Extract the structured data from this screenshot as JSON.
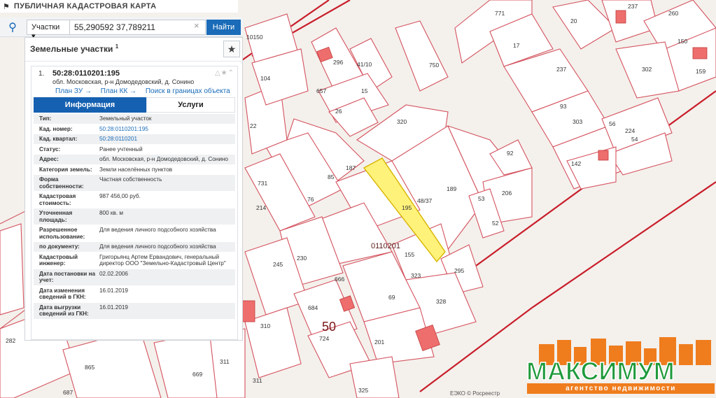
{
  "app": {
    "title": "ПУБЛИЧНАЯ КАДАСТРОВАЯ КАРТА"
  },
  "search": {
    "type_label": "Участки",
    "query": "55,290592 37,789211",
    "find_label": "Найти"
  },
  "panel": {
    "title": "Земельные участки",
    "count_sup": "1"
  },
  "card": {
    "index": "1.",
    "cadastral_number": "50:28:0110201:195",
    "address": "обл. Московская, р-н Домодедовский, д. Сонино",
    "links": [
      "План ЗУ →",
      "План КК →",
      "Поиск в границах объекта →"
    ]
  },
  "tabs": {
    "info": "Информация",
    "services": "Услуги"
  },
  "properties": [
    {
      "key": "Тип:",
      "value": "Земельный участок"
    },
    {
      "key": "Кад. номер:",
      "value": "50:28:0110201:195"
    },
    {
      "key": "Кад. квартал:",
      "value": "50:28:0110201"
    },
    {
      "key": "Статус:",
      "value": "Ранее учтенный"
    },
    {
      "key": "Адрес:",
      "value": "обл. Московская, р-н Домодедовский, д. Сонино"
    },
    {
      "key": "Категория земель:",
      "value": "Земли населённых пунктов"
    },
    {
      "key": "Форма собственности:",
      "value": "Частная собственность"
    },
    {
      "key": "Кадастровая стоимость:",
      "value": "987 456,00 руб."
    },
    {
      "key": "Уточненная площадь:",
      "value": "800 кв. м"
    },
    {
      "key": "Разрешенное использование:",
      "value": "Для ведения личного подсобного хозяйства"
    },
    {
      "key": "по документу:",
      "value": "Для ведения личного подсобного хозяйства"
    },
    {
      "key": "Кадастровый инженер:",
      "value": "Григорьянц Артем Ервандович, генеральный директор ООО \"Земельно-Кадастровый Центр\""
    },
    {
      "key": "Дата постановки на учет:",
      "value": "02.02.2006"
    },
    {
      "key": "Дата изменения сведений в ГКН:",
      "value": "16.01.2019"
    },
    {
      "key": "Дата выгрузки сведений из ГКН:",
      "value": "16.01.2019"
    }
  ],
  "map": {
    "quarter_label": "0110201",
    "region_label": "50",
    "highlight_label": "195",
    "attribution": "ЕЭКО © Росреестр",
    "parcel_numbers": [
      "771",
      "237",
      "17",
      "20",
      "260",
      "150",
      "302",
      "159",
      "237",
      "296",
      "41/10",
      "750",
      "104",
      "657",
      "15",
      "26",
      "22",
      "320",
      "93",
      "303",
      "56",
      "224",
      "54",
      "92",
      "142",
      "187",
      "85",
      "189",
      "206",
      "48/37",
      "53",
      "52",
      "731",
      "214",
      "76",
      "230",
      "155",
      "295",
      "323",
      "245",
      "666",
      "69",
      "328",
      "684",
      "310",
      "724",
      "201",
      "282",
      "865",
      "669",
      "311",
      "687",
      "311",
      "325",
      "10150"
    ]
  },
  "logo": {
    "word": "МАКСИМУМ",
    "subtitle": "агентство недвижимости"
  }
}
